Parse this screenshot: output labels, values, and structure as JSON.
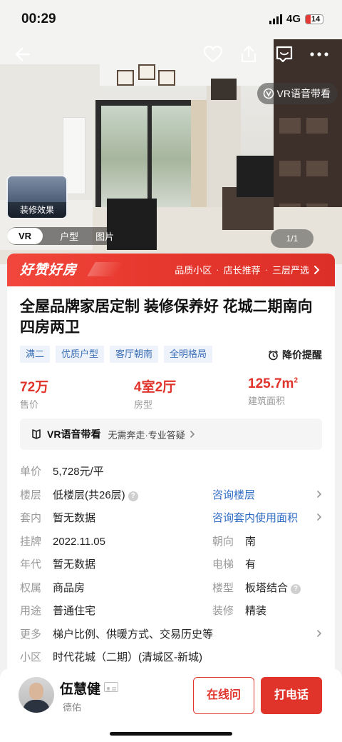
{
  "status_bar": {
    "time": "00:29",
    "network": "4G",
    "battery": "14"
  },
  "hero": {
    "vr_voice_chip": "VR语音带看",
    "deco_thumb_label": "装修效果",
    "media_tabs": [
      "VR",
      "户型",
      "图片"
    ],
    "page_counter": "1/1"
  },
  "promo": {
    "logo": "好赞好房",
    "tags": [
      "品质小区",
      "店长推荐",
      "三层严选"
    ],
    "separator": "·"
  },
  "listing": {
    "title": "全屋品牌家居定制 装修保养好 花城二期南向四房两卫",
    "tags": [
      "满二",
      "优质户型",
      "客厅朝南",
      "全明格局"
    ],
    "price_alert": "降价提醒",
    "stats": {
      "price": {
        "value": "72万",
        "label": "售价"
      },
      "layout": {
        "value": "4室2厅",
        "label": "房型"
      },
      "area": {
        "value": "125.7m",
        "sup": "2",
        "label": "建筑面积"
      }
    },
    "vr_bar": {
      "name": "VR语音带看",
      "desc": "无需奔走·专业答疑"
    },
    "info": {
      "unit_price": {
        "label": "单价",
        "value": "5,728元/平"
      },
      "floor": {
        "label": "楼层",
        "value": "低楼层(共26层)",
        "link": "咨询楼层"
      },
      "inner": {
        "label": "套内",
        "value": "暂无数据",
        "link": "咨询套内使用面积"
      },
      "listed": {
        "label": "挂牌",
        "value": "2022.11.05"
      },
      "orientation": {
        "label": "朝向",
        "value": "南"
      },
      "year": {
        "label": "年代",
        "value": "暂无数据"
      },
      "elevator": {
        "label": "电梯",
        "value": "有"
      },
      "ownership": {
        "label": "权属",
        "value": "商品房"
      },
      "building_type": {
        "label": "楼型",
        "value": "板塔结合"
      },
      "usage": {
        "label": "用途",
        "value": "普通住宅"
      },
      "decoration": {
        "label": "装修",
        "value": "精装"
      },
      "more": {
        "label": "更多",
        "value": "梯户比例、供暖方式、交易历史等"
      },
      "community": {
        "label": "小区",
        "value": "时代花城（二期）(清城区-新城)"
      }
    }
  },
  "agent": {
    "name": "伍慧健",
    "company": "德佑",
    "chat_label": "在线问",
    "call_label": "打电话"
  },
  "colors": {
    "accent": "#e0332a",
    "link": "#2e6bc5",
    "tag_bg": "#eef3fb",
    "tag_text": "#3b6fb6"
  }
}
